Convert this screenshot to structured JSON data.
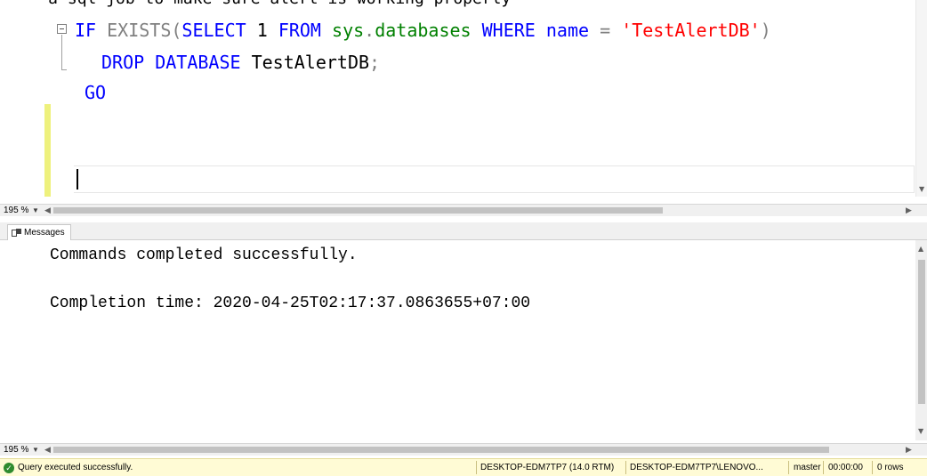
{
  "editor": {
    "top_clipped_text": "Test a sql job to make sure alert is working properly",
    "lines": [
      {
        "tokens": [
          {
            "t": "IF ",
            "c": "kw"
          },
          {
            "t": "EXISTS",
            "c": "op"
          },
          {
            "t": "(",
            "c": "op"
          },
          {
            "t": "SELECT ",
            "c": "kw"
          },
          {
            "t": "1 ",
            "c": "plain"
          },
          {
            "t": "FROM ",
            "c": "kw"
          },
          {
            "t": "sys",
            "c": "obj"
          },
          {
            "t": ".",
            "c": "op"
          },
          {
            "t": "databases ",
            "c": "obj"
          },
          {
            "t": "WHERE ",
            "c": "kw"
          },
          {
            "t": "name ",
            "c": "kw"
          },
          {
            "t": "= ",
            "c": "op"
          },
          {
            "t": "'TestAlertDB'",
            "c": "str"
          },
          {
            "t": ")",
            "c": "op"
          }
        ]
      },
      {
        "tokens": [
          {
            "t": "DROP ",
            "c": "kw"
          },
          {
            "t": "DATABASE ",
            "c": "kw"
          },
          {
            "t": "TestAlertDB",
            "c": "plain"
          },
          {
            "t": ";",
            "c": "op"
          }
        ]
      },
      {
        "tokens": [
          {
            "t": "GO",
            "c": "kw"
          }
        ]
      }
    ]
  },
  "editor_zoom": "195 %",
  "results": {
    "tab_label": "Messages",
    "messages": [
      "Commands completed successfully.",
      "Completion time: 2020-04-25T02:17:37.0863655+07:00"
    ],
    "zoom": "195 %"
  },
  "status": {
    "message": "Query executed successfully.",
    "server": "DESKTOP-EDM7TP7 (14.0 RTM)",
    "user": "DESKTOP-EDM7TP7\\LENOVO...",
    "database": "master",
    "elapsed": "00:00:00",
    "rows": "0 rows",
    "bar_color": "#fffbd5",
    "success_color": "#2e8b2e"
  }
}
